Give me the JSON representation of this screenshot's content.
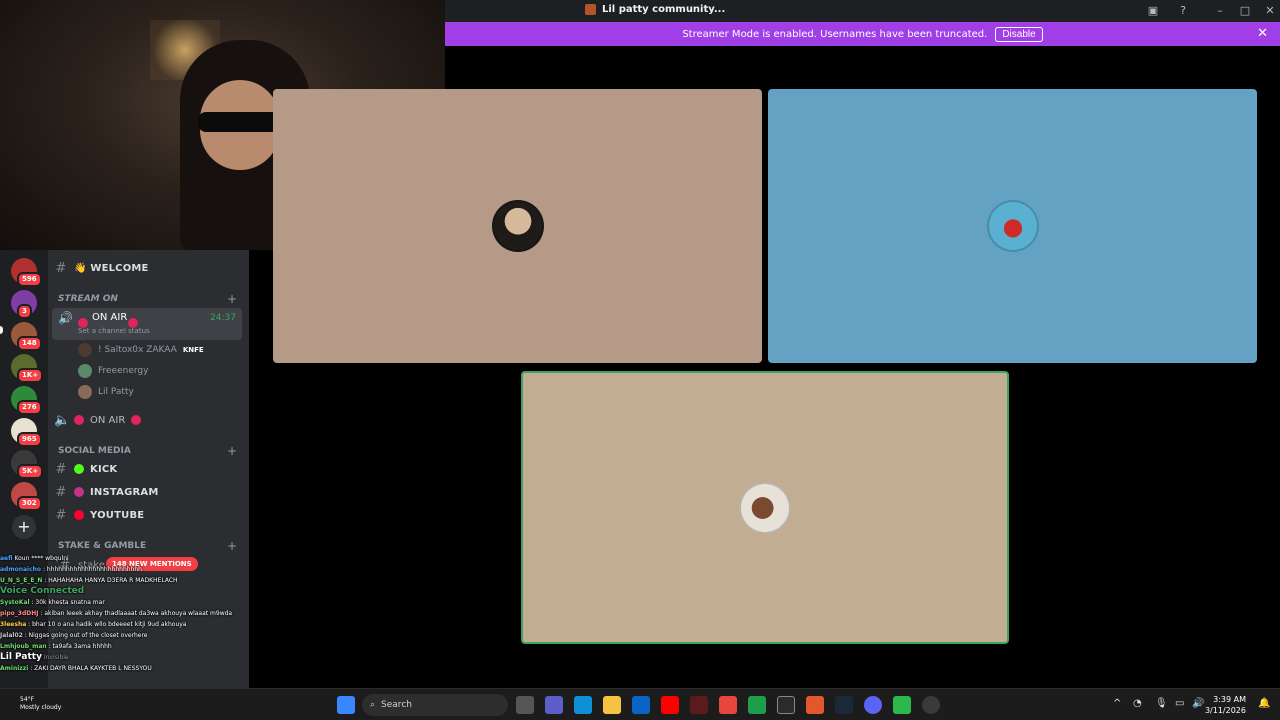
{
  "window": {
    "title": "Lil patty community...",
    "controls": [
      "minimize",
      "maximize",
      "close"
    ]
  },
  "banner": {
    "message": "Streamer Mode is enabled. Usernames have been truncated.",
    "disable_label": "Disable",
    "close_glyph": "✕"
  },
  "webcam": {
    "label": "Streamer webcam feed"
  },
  "call": {
    "tiles": [
      {
        "avatar": "participant-avatar-1",
        "color": "#b59a87"
      },
      {
        "avatar": "participant-avatar-2",
        "color": "#64a2c4"
      },
      {
        "avatar": "participant-avatar-3",
        "color": "#c2ac92",
        "speaking": true
      }
    ]
  },
  "servers": {
    "badges": [
      "596",
      "3",
      "148",
      "1K+",
      "276",
      "965",
      "5K+",
      "302"
    ],
    "add_glyph": "+"
  },
  "channels": {
    "welcome": "👋 WELCOME",
    "cat_stream": "STREAM ON",
    "voice_on_air": "ON AIR",
    "voice_timer": "24:37",
    "voice_status": "Set a channel status",
    "members": [
      {
        "name": "! Saltox0x ZAKAA",
        "tag": "KNFE"
      },
      {
        "name": "Freeenergy"
      },
      {
        "name": "Lil Patty"
      }
    ],
    "voice_on_air_2": "ON AIR",
    "cat_social": "SOCIAL MEDIA",
    "kick": "KICK",
    "instagram": "INSTAGRAM",
    "youtube": "YOUTUBE",
    "cat_stake": "STAKE & GAMBLE",
    "stake": "stake",
    "new_mentions": "148 NEW MENTIONS"
  },
  "chat": [
    {
      "user": "aefi",
      "text": "Koun **** wbqulni"
    },
    {
      "user": "admonaicho",
      "text": "hhhhhhhhhhhhhhhhhhhhhhhhh"
    },
    {
      "user": "U_N_S_E_E_N",
      "text": "HAHAHAHA HANYA D3ERA R MADKHELACH"
    },
    {
      "user": "Voice Connected",
      "text": ""
    },
    {
      "user": "SystoKal",
      "text": "30k khesta snatna mar"
    },
    {
      "user": "pipo_3dDHJ",
      "text": "akiban leeek akhay thadlaaaat da3wa akhouya wlaaat m9wda"
    },
    {
      "user": "3leesha",
      "text": "bhar 10 o ana hadik wllo bdeeeet kitji 9ud akhouya"
    },
    {
      "user": "Jalal02",
      "text": "Niggas going out of the closet overhere"
    },
    {
      "user": "Lmhjoub_man",
      "text": "ta9afa 3ama hhhhh"
    },
    {
      "user": "Lil Patty",
      "text": "Invisible"
    },
    {
      "user": "Aminizzi",
      "text": "ZAKI DAYR BHALA KAYKTEB L NESSYOU"
    }
  ],
  "taskbar": {
    "weather_temp": "54°F",
    "weather_desc": "Mostly cloudy",
    "search_label": "Search",
    "time": "3:39 AM",
    "date": "3/11/2026"
  }
}
